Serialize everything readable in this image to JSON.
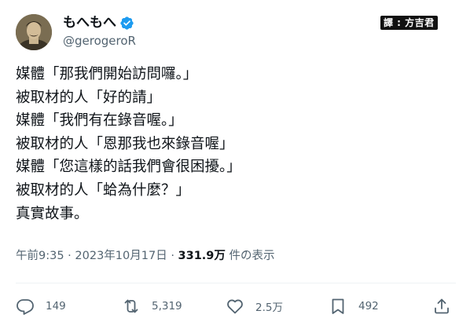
{
  "user": {
    "display_name": "もへもへ",
    "handle": "@gerogeroR",
    "verified": true
  },
  "translation_badge": "譯 : 方吉君",
  "tweet": {
    "lines": [
      "媒體「那我們開始訪問囉。」",
      "被取材的人「好的請」",
      "媒體「我們有在錄音喔。」",
      "被取材的人「恩那我也來錄音喔」",
      "媒體「您這樣的話我們會很困擾。」",
      "被取材的人「蛤為什麼？」",
      "真實故事。"
    ]
  },
  "meta": {
    "time": "午前9:35",
    "separator": "·",
    "date": "2023年10月17日",
    "views_count": "331.9万",
    "views_label": "件の表示"
  },
  "actions": {
    "reply": {
      "icon": "reply-icon",
      "count": "149"
    },
    "retweet": {
      "icon": "retweet-icon",
      "count": "5,319"
    },
    "like": {
      "icon": "heart-icon",
      "count": "2.5万"
    },
    "bookmark": {
      "icon": "bookmark-icon",
      "count": "492"
    },
    "share": {
      "icon": "share-icon"
    }
  },
  "colors": {
    "verified_blue": "#1d9bf0",
    "text_secondary": "#536471",
    "text_primary": "#0f1419"
  }
}
